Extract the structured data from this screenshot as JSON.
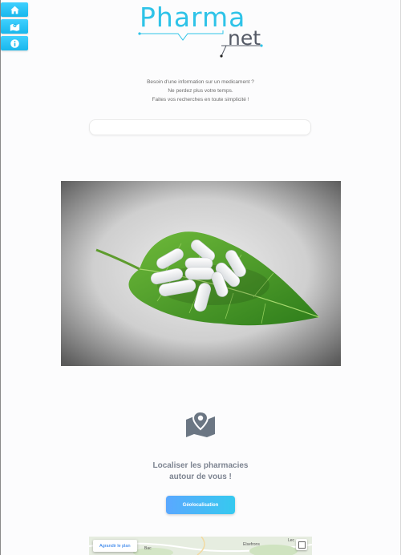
{
  "logo": {
    "part1": "Pharma",
    "part2": "net"
  },
  "tagline": [
    "Besoin d'une information sur un medicament ?",
    "Ne perdez plus votre temps.",
    "Faites vos recherches en toute simplicité !"
  ],
  "search": {
    "value": "",
    "placeholder": ""
  },
  "locate": {
    "title_line1": "Localiser les pharmacies",
    "title_line2": "autour de vous !"
  },
  "geo_button": "Géolocalisation",
  "map": {
    "enlarge_label": "Agrandir le plan",
    "label_left": "Bac",
    "label_center": "Elsefrons",
    "label_right": "Lec"
  },
  "icons": [
    "home-icon",
    "map-icon",
    "info-icon",
    "map-pin-icon",
    "fullscreen-icon"
  ],
  "colors": {
    "accent": "#2ec3e8",
    "button_start": "#5aa8ff",
    "button_end": "#36c9ef",
    "logo_dark": "#555a66"
  }
}
